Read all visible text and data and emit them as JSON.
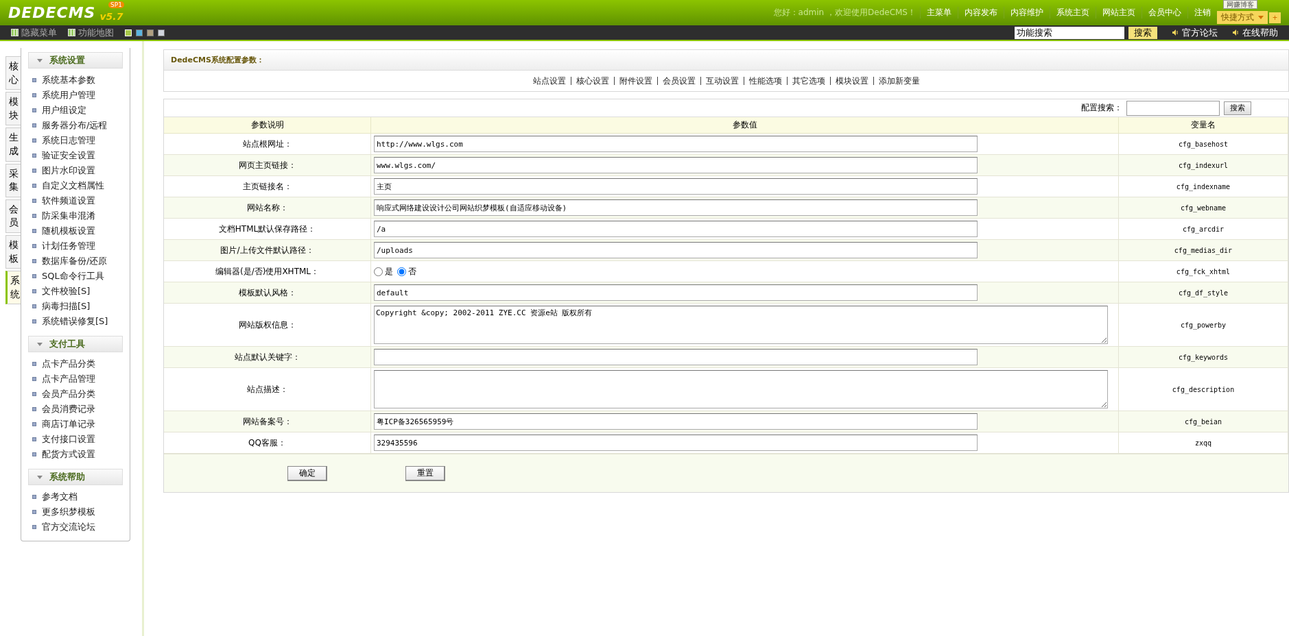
{
  "header": {
    "logo": "DEDECMS",
    "badge": "SP1",
    "version": "v5.7",
    "greeting": "您好：admin ，欢迎使用DedeCMS！",
    "nav": [
      "主菜单",
      "内容发布",
      "内容维护",
      "系统主页",
      "网站主页",
      "会员中心",
      "注销"
    ],
    "shortcut": "快捷方式",
    "tooltip": "网赚博客",
    "add_button": "+"
  },
  "toolbar": {
    "hide_menu": "隐藏菜单",
    "function_map": "功能地图",
    "skins": [
      {
        "color": "#a8c84a",
        "selected": true
      },
      {
        "color": "#5ab4e0",
        "selected": false
      },
      {
        "color": "#b0a080",
        "selected": false
      },
      {
        "color": "#d0d4dc",
        "selected": false
      }
    ],
    "search_value": "功能搜索",
    "search_button": "搜索",
    "links": [
      "官方论坛",
      "在线帮助"
    ]
  },
  "side_tabs": [
    {
      "label": "核心",
      "selected": false
    },
    {
      "label": "模块",
      "selected": false
    },
    {
      "label": "生成",
      "selected": false
    },
    {
      "label": "采集",
      "selected": false
    },
    {
      "label": "会员",
      "selected": false
    },
    {
      "label": "模板",
      "selected": false
    },
    {
      "label": "系统",
      "selected": true
    }
  ],
  "sidebar": [
    {
      "title": "系统设置",
      "expanded": true,
      "items": [
        "系统基本参数",
        "系统用户管理",
        "用户组设定",
        "服务器分布/远程",
        "系统日志管理",
        "验证安全设置",
        "图片水印设置",
        "自定义文档属性",
        "软件频道设置",
        "防采集串混淆",
        "随机模板设置",
        "计划任务管理",
        "数据库备份/还原",
        "SQL命令行工具",
        "文件校验[S]",
        "病毒扫描[S]",
        "系统错误修复[S]"
      ]
    },
    {
      "title": "支付工具",
      "expanded": true,
      "items": [
        "点卡产品分类",
        "点卡产品管理",
        "会员产品分类",
        "会员消费记录",
        "商店订单记录",
        "支付接口设置",
        "配货方式设置"
      ]
    },
    {
      "title": "系统帮助",
      "expanded": true,
      "items": [
        "参考文档",
        "更多织梦模板",
        "官方交流论坛"
      ]
    }
  ],
  "panel": {
    "title": "DedeCMS系统配置参数：",
    "tabs": [
      "站点设置",
      "核心设置",
      "附件设置",
      "会员设置",
      "互动设置",
      "性能选项",
      "其它选项",
      "模块设置",
      "添加新变量"
    ]
  },
  "config": {
    "search_label": "配置搜索：",
    "search_button": "搜索",
    "columns": [
      "参数说明",
      "参数值",
      "变量名"
    ],
    "rows": [
      {
        "kind": "input",
        "label": "站点根网址：",
        "value": "http://www.wlgs.com",
        "var": "cfg_basehost"
      },
      {
        "kind": "input",
        "label": "网页主页链接：",
        "value": "www.wlgs.com/",
        "var": "cfg_indexurl"
      },
      {
        "kind": "input",
        "label": "主页链接名：",
        "value": "主页",
        "var": "cfg_indexname"
      },
      {
        "kind": "input",
        "label": "网站名称：",
        "value": "响应式网络建设设计公司网站织梦模板(自适应移动设备)",
        "var": "cfg_webname"
      },
      {
        "kind": "input",
        "label": "文档HTML默认保存路径：",
        "value": "/a",
        "var": "cfg_arcdir"
      },
      {
        "kind": "input",
        "label": "图片/上传文件默认路径：",
        "value": "/uploads",
        "var": "cfg_medias_dir"
      },
      {
        "kind": "radio",
        "label": "编辑器(是/否)使用XHTML：",
        "options": [
          {
            "label": "是",
            "selected": false
          },
          {
            "label": "否",
            "selected": true
          }
        ],
        "var": "cfg_fck_xhtml"
      },
      {
        "kind": "input",
        "label": "模板默认风格：",
        "value": "default",
        "var": "cfg_df_style"
      },
      {
        "kind": "textarea",
        "label": "网站版权信息：",
        "value": "Copyright &copy; 2002-2011 ZYE.CC 资源e站 版权所有",
        "var": "cfg_powerby"
      },
      {
        "kind": "input",
        "label": "站点默认关键字：",
        "value": "",
        "var": "cfg_keywords"
      },
      {
        "kind": "textarea",
        "label": "站点描述：",
        "value": "",
        "var": "cfg_description"
      },
      {
        "kind": "input",
        "label": "网站备案号：",
        "value": "粤ICP备326565959号",
        "var": "cfg_beian"
      },
      {
        "kind": "input",
        "label": "QQ客服：",
        "value": "329435596",
        "var": "zxqq"
      }
    ],
    "buttons": [
      "确定",
      "重置"
    ]
  }
}
